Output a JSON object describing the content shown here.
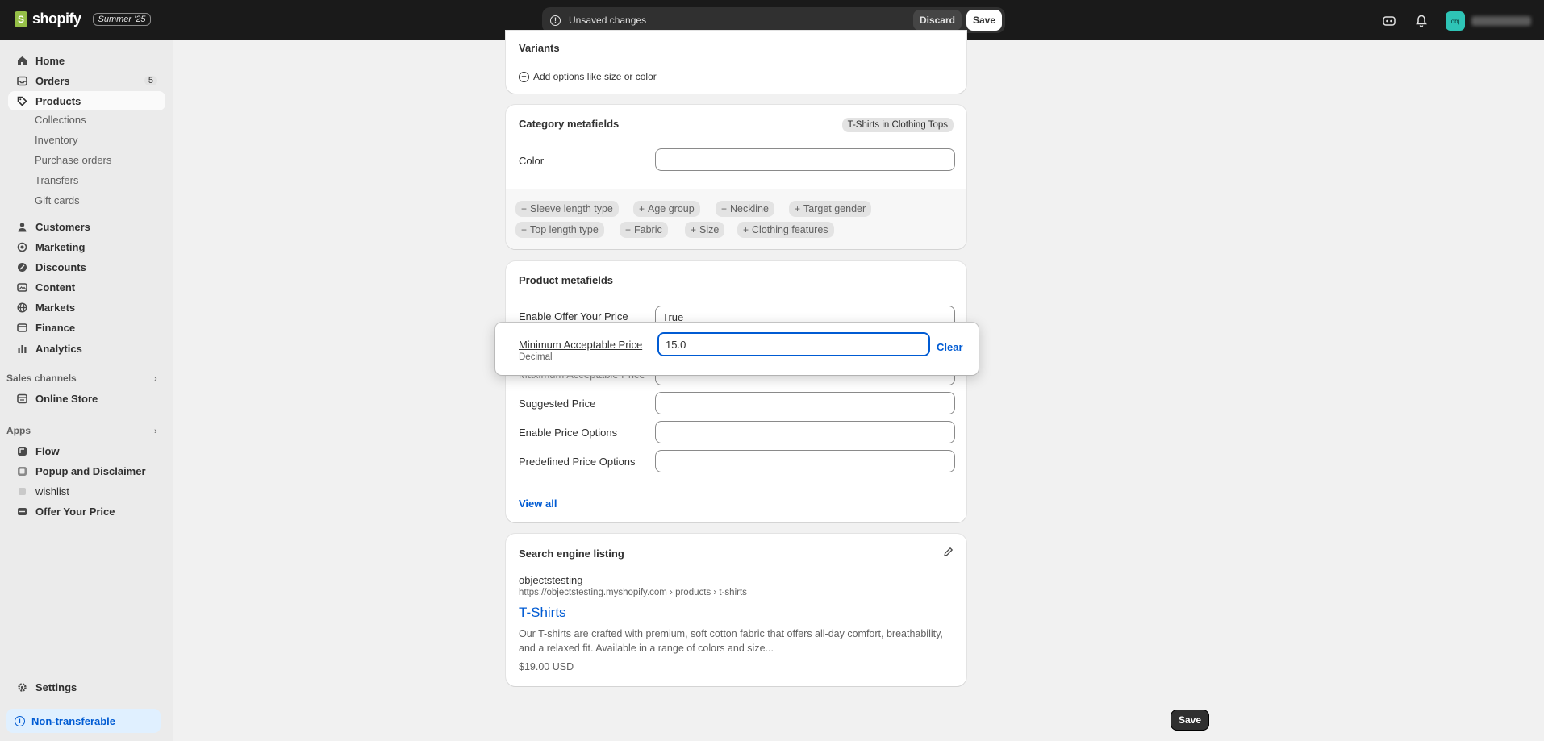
{
  "topbar": {
    "brand": "shopify",
    "edition": "Summer '25",
    "unsaved_text": "Unsaved changes",
    "discard_label": "Discard",
    "save_label": "Save",
    "avatar_initials": "obj"
  },
  "sidebar": {
    "items": [
      {
        "label": "Home",
        "icon": "home-icon"
      },
      {
        "label": "Orders",
        "icon": "inbox-icon",
        "count": "5"
      },
      {
        "label": "Products",
        "icon": "tag-icon"
      },
      {
        "label": "Customers",
        "icon": "person-icon"
      },
      {
        "label": "Marketing",
        "icon": "target-icon"
      },
      {
        "label": "Discounts",
        "icon": "discount-icon"
      },
      {
        "label": "Content",
        "icon": "content-icon"
      },
      {
        "label": "Markets",
        "icon": "globe-icon"
      },
      {
        "label": "Finance",
        "icon": "bank-icon"
      },
      {
        "label": "Analytics",
        "icon": "chart-icon"
      }
    ],
    "product_subitems": [
      "Collections",
      "Inventory",
      "Purchase orders",
      "Transfers",
      "Gift cards"
    ],
    "sales_channels_label": "Sales channels",
    "online_store": "Online Store",
    "apps_label": "Apps",
    "apps": [
      "Flow",
      "Popup and Disclaimer",
      "wishlist",
      "Offer Your Price"
    ],
    "settings": "Settings",
    "non_transferable": "Non-transferable"
  },
  "variants": {
    "title": "Variants",
    "add_options": "Add options like size or color"
  },
  "category_metafields": {
    "title": "Category metafields",
    "category_tag": "T-Shirts in Clothing Tops",
    "color_label": "Color",
    "color_value": "",
    "chips_row1": [
      "Sleeve length type",
      "Age group",
      "Neckline",
      "Target gender"
    ],
    "chips_row2": [
      "Top length type",
      "Fabric",
      "Size",
      "Clothing features"
    ]
  },
  "product_metafields": {
    "title": "Product metafields",
    "fields": [
      {
        "label": "Enable Offer Your Price",
        "value": "True"
      },
      {
        "label": "Maximum Acceptable Price",
        "value": ""
      },
      {
        "label": "Suggested Price",
        "value": ""
      },
      {
        "label": "Enable Price Options",
        "value": ""
      },
      {
        "label": "Predefined Price Options",
        "value": ""
      }
    ],
    "view_all": "View all"
  },
  "popover": {
    "label": "Minimum Acceptable Price",
    "type": "Decimal",
    "value": "15.0",
    "clear": "Clear"
  },
  "seo": {
    "title": "Search engine listing",
    "store": "objectstesting",
    "url": "https://objectstesting.myshopify.com › products › t-shirts",
    "page_title": "T-Shirts",
    "description": "Our T-shirts are crafted with premium, soft cotton fabric that offers all-day comfort, breathability, and a relaxed fit. Available in a range of colors and size...",
    "price": "$19.00 USD"
  },
  "footer": {
    "save_label": "Save"
  }
}
